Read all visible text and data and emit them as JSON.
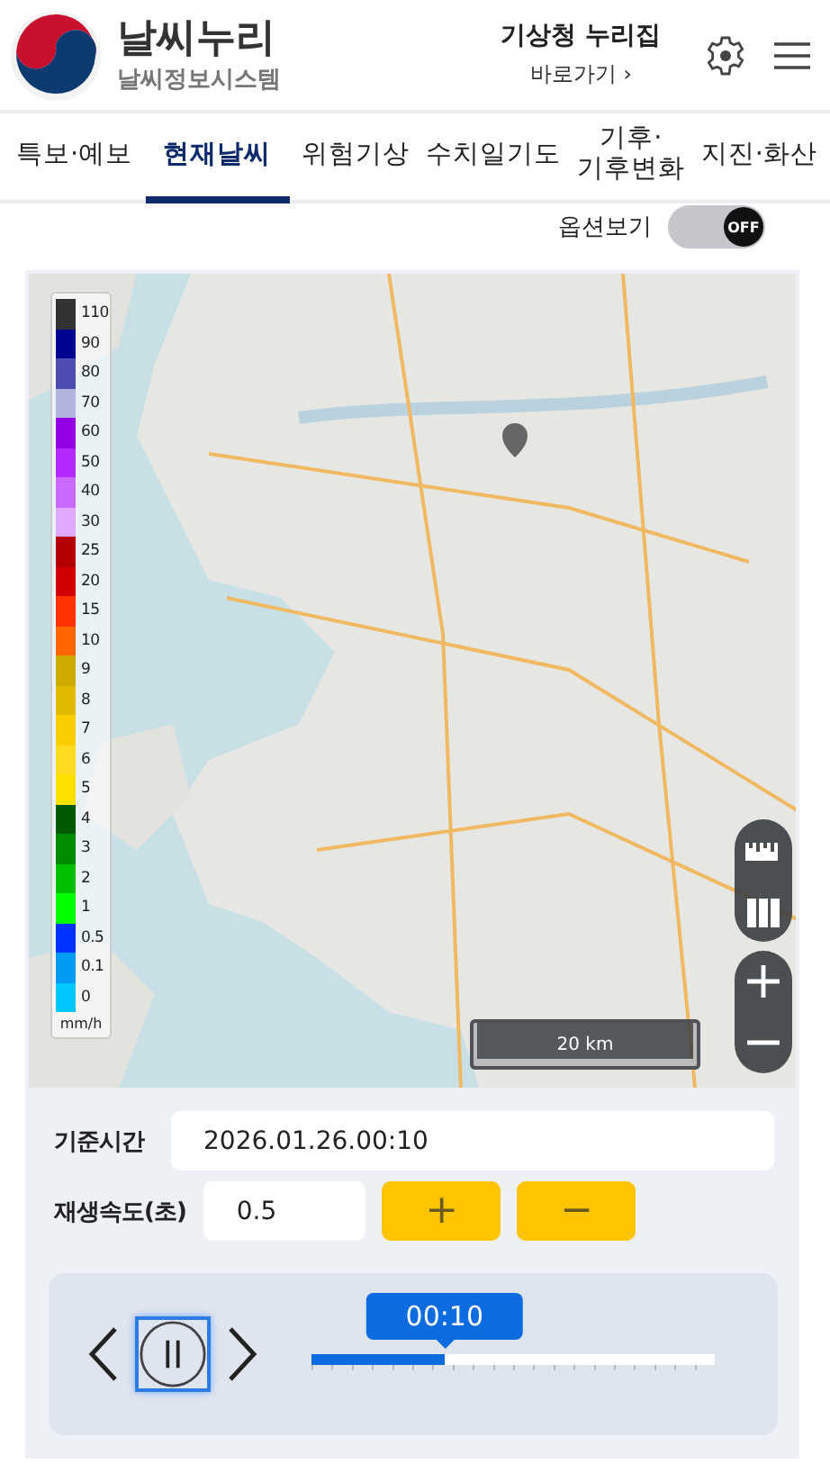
{
  "header": {
    "title": "날씨누리",
    "subtitle": "날씨정보시스템",
    "link_title": "기상청 누리집",
    "link_sub": "바로가기 ›"
  },
  "tabs": [
    {
      "label": "특보·예보",
      "selected": false
    },
    {
      "label": "현재날씨",
      "selected": true
    },
    {
      "label": "위험기상",
      "selected": false
    },
    {
      "label": "수치일기도",
      "selected": false
    },
    {
      "label": "기후·\n기후변화",
      "selected": false
    },
    {
      "label": "지진·화산",
      "selected": false
    }
  ],
  "option_toggle": {
    "label": "옵션보기",
    "on": false,
    "state_text": "OFF"
  },
  "map": {
    "kind": "picture",
    "scale": "20 km",
    "legend": {
      "unit": "mm/h",
      "items": [
        {
          "label": "110",
          "color": "#333333"
        },
        {
          "label": "90",
          "color": "#000390"
        },
        {
          "label": "80",
          "color": "#4c4eb1"
        },
        {
          "label": "70",
          "color": "#b3b4de"
        },
        {
          "label": "60",
          "color": "#9300e4"
        },
        {
          "label": "50",
          "color": "#b329ff"
        },
        {
          "label": "40",
          "color": "#c969ff"
        },
        {
          "label": "30",
          "color": "#e0a9ff"
        },
        {
          "label": "25",
          "color": "#b40000"
        },
        {
          "label": "20",
          "color": "#d20000"
        },
        {
          "label": "15",
          "color": "#ff3200"
        },
        {
          "label": "10",
          "color": "#ff6600"
        },
        {
          "label": "9",
          "color": "#ccaa00"
        },
        {
          "label": "8",
          "color": "#e0b900"
        },
        {
          "label": "7",
          "color": "#f9cd00"
        },
        {
          "label": "6",
          "color": "#ffdc1f"
        },
        {
          "label": "5",
          "color": "#ffe100"
        },
        {
          "label": "4",
          "color": "#005a00"
        },
        {
          "label": "3",
          "color": "#008c00"
        },
        {
          "label": "2",
          "color": "#00be00"
        },
        {
          "label": "1",
          "color": "#00ff00"
        },
        {
          "label": "0.5",
          "color": "#0033ff"
        },
        {
          "label": "0.1",
          "color": "#009bf5"
        },
        {
          "label": "0",
          "color": "#00c8ff"
        }
      ]
    }
  },
  "base_time": {
    "label": "기준시간",
    "value": "2026.01.26.00:10"
  },
  "speed": {
    "label": "재생속도(초)",
    "value": "0.5",
    "buttons": [
      "+",
      "−"
    ]
  },
  "player": {
    "time": "00:10",
    "level": 0.33,
    "playing": true
  }
}
